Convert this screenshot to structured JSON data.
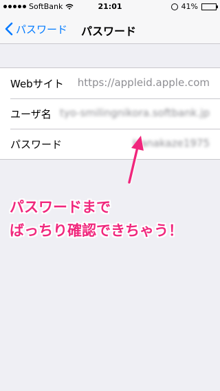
{
  "status_bar": {
    "carrier": "SoftBank",
    "time": "21:01",
    "battery_percent": "41%",
    "battery_level": 0.41
  },
  "navbar": {
    "back_label": "パスワード",
    "title": "パスワード"
  },
  "rows": [
    {
      "label": "Webサイト",
      "value": "https://appleid.apple.com"
    },
    {
      "label": "ユーザ名",
      "value": "tyo-smilingnikora.softbank.jp"
    },
    {
      "label": "パスワード",
      "value": "Hanakaze1975"
    }
  ],
  "caption": {
    "line1": "パスワードまで",
    "line2": "ばっちり確認できちゃう！"
  },
  "colors": {
    "accent": "#007aff",
    "annotation": "#f0287d"
  },
  "icons": [
    "signal-dots-icon",
    "wifi-icon",
    "rotation-lock-icon",
    "battery-icon",
    "chevron-left-icon",
    "arrow-icon"
  ]
}
